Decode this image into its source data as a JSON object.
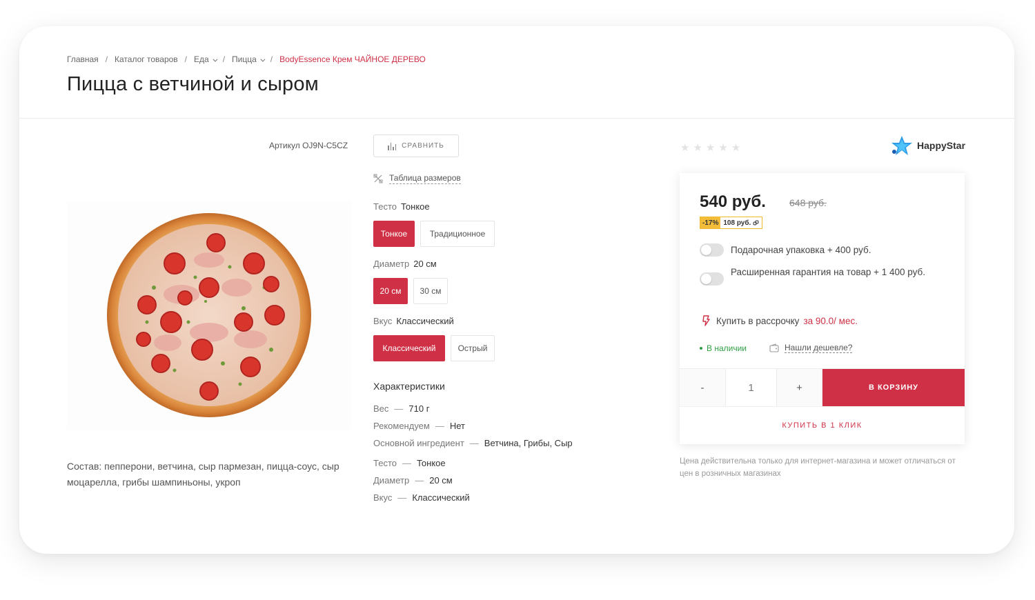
{
  "breadcrumbs": {
    "items": [
      "Главная",
      "Каталог товаров",
      "Еда",
      "Пицца"
    ],
    "current": "BodyEssence Крем ЧАЙНОЕ ДЕРЕВО",
    "separator": "/"
  },
  "title": "Пицца с ветчиной и сыром",
  "sku": "Артикул OJ9N-C5CZ",
  "compare_label": "СРАВНИТЬ",
  "size_table_label": "Таблица размеров",
  "options": {
    "dough": {
      "label": "Тесто",
      "selected": "Тонкое",
      "values": [
        "Тонкое",
        "Традиционное"
      ]
    },
    "diameter": {
      "label": "Диаметр",
      "selected": "20 см",
      "values": [
        "20 см",
        "30 см"
      ]
    },
    "taste": {
      "label": "Вкус",
      "selected": "Классический",
      "values": [
        "Классический",
        "Острый"
      ]
    }
  },
  "characteristics": {
    "title": "Характеристики",
    "rows": [
      {
        "name": "Вес",
        "value": "710 г"
      },
      {
        "name": "Рекомендуем",
        "value": "Нет"
      },
      {
        "name": "Основной ингредиент",
        "value": "Ветчина, Грибы, Сыр"
      },
      {
        "name": "Тесто",
        "value": "Тонкое"
      },
      {
        "name": "Диаметр",
        "value": "20 см"
      },
      {
        "name": "Вкус",
        "value": "Классический"
      }
    ]
  },
  "composition": "Состав: пепперони, ветчина, сыр пармезан, пицца-соус, сыр моцарелла, грибы шампиньоны, укроп",
  "rating": {
    "value": 0,
    "max": 5
  },
  "brand": "HappyStar",
  "price": {
    "current": "540 руб.",
    "old": "648 руб.",
    "discount_percent": "-17%",
    "discount_amount": "108 руб."
  },
  "addons": [
    {
      "label": "Подарочная упаковка + 400 руб.",
      "enabled": false
    },
    {
      "label": "Расширенная гарантия на товар + 1 400 руб.",
      "enabled": false
    }
  ],
  "installment": {
    "label": "Купить в рассрочку",
    "amount": "за 90.0/ мес."
  },
  "stock_label": "В наличии",
  "cheaper_label": "Нашли дешевле?",
  "quantity": {
    "minus": "-",
    "value": "1",
    "plus": "+"
  },
  "cart_button": "В КОРЗИНУ",
  "one_click": "КУПИТЬ В 1 КЛИК",
  "price_note": "Цена действительна только для интернет-магазина и может отличаться от цен в розничных магазинах",
  "colors": {
    "accent": "#cf3045",
    "stock": "#2f9e44",
    "discount": "#f3bd3a"
  }
}
